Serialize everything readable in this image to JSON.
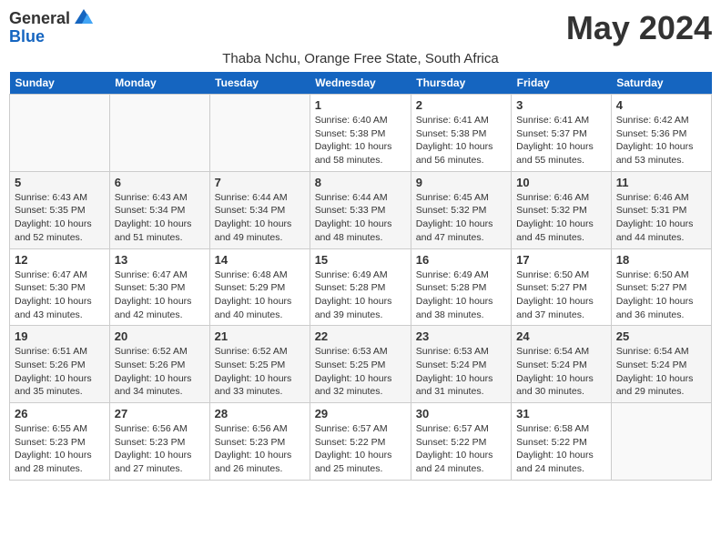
{
  "header": {
    "logo_general": "General",
    "logo_blue": "Blue",
    "month_title": "May 2024",
    "location": "Thaba Nchu, Orange Free State, South Africa"
  },
  "days_of_week": [
    "Sunday",
    "Monday",
    "Tuesday",
    "Wednesday",
    "Thursday",
    "Friday",
    "Saturday"
  ],
  "weeks": [
    [
      {
        "day": "",
        "info": ""
      },
      {
        "day": "",
        "info": ""
      },
      {
        "day": "",
        "info": ""
      },
      {
        "day": "1",
        "info": "Sunrise: 6:40 AM\nSunset: 5:38 PM\nDaylight: 10 hours and 58 minutes."
      },
      {
        "day": "2",
        "info": "Sunrise: 6:41 AM\nSunset: 5:38 PM\nDaylight: 10 hours and 56 minutes."
      },
      {
        "day": "3",
        "info": "Sunrise: 6:41 AM\nSunset: 5:37 PM\nDaylight: 10 hours and 55 minutes."
      },
      {
        "day": "4",
        "info": "Sunrise: 6:42 AM\nSunset: 5:36 PM\nDaylight: 10 hours and 53 minutes."
      }
    ],
    [
      {
        "day": "5",
        "info": "Sunrise: 6:43 AM\nSunset: 5:35 PM\nDaylight: 10 hours and 52 minutes."
      },
      {
        "day": "6",
        "info": "Sunrise: 6:43 AM\nSunset: 5:34 PM\nDaylight: 10 hours and 51 minutes."
      },
      {
        "day": "7",
        "info": "Sunrise: 6:44 AM\nSunset: 5:34 PM\nDaylight: 10 hours and 49 minutes."
      },
      {
        "day": "8",
        "info": "Sunrise: 6:44 AM\nSunset: 5:33 PM\nDaylight: 10 hours and 48 minutes."
      },
      {
        "day": "9",
        "info": "Sunrise: 6:45 AM\nSunset: 5:32 PM\nDaylight: 10 hours and 47 minutes."
      },
      {
        "day": "10",
        "info": "Sunrise: 6:46 AM\nSunset: 5:32 PM\nDaylight: 10 hours and 45 minutes."
      },
      {
        "day": "11",
        "info": "Sunrise: 6:46 AM\nSunset: 5:31 PM\nDaylight: 10 hours and 44 minutes."
      }
    ],
    [
      {
        "day": "12",
        "info": "Sunrise: 6:47 AM\nSunset: 5:30 PM\nDaylight: 10 hours and 43 minutes."
      },
      {
        "day": "13",
        "info": "Sunrise: 6:47 AM\nSunset: 5:30 PM\nDaylight: 10 hours and 42 minutes."
      },
      {
        "day": "14",
        "info": "Sunrise: 6:48 AM\nSunset: 5:29 PM\nDaylight: 10 hours and 40 minutes."
      },
      {
        "day": "15",
        "info": "Sunrise: 6:49 AM\nSunset: 5:28 PM\nDaylight: 10 hours and 39 minutes."
      },
      {
        "day": "16",
        "info": "Sunrise: 6:49 AM\nSunset: 5:28 PM\nDaylight: 10 hours and 38 minutes."
      },
      {
        "day": "17",
        "info": "Sunrise: 6:50 AM\nSunset: 5:27 PM\nDaylight: 10 hours and 37 minutes."
      },
      {
        "day": "18",
        "info": "Sunrise: 6:50 AM\nSunset: 5:27 PM\nDaylight: 10 hours and 36 minutes."
      }
    ],
    [
      {
        "day": "19",
        "info": "Sunrise: 6:51 AM\nSunset: 5:26 PM\nDaylight: 10 hours and 35 minutes."
      },
      {
        "day": "20",
        "info": "Sunrise: 6:52 AM\nSunset: 5:26 PM\nDaylight: 10 hours and 34 minutes."
      },
      {
        "day": "21",
        "info": "Sunrise: 6:52 AM\nSunset: 5:25 PM\nDaylight: 10 hours and 33 minutes."
      },
      {
        "day": "22",
        "info": "Sunrise: 6:53 AM\nSunset: 5:25 PM\nDaylight: 10 hours and 32 minutes."
      },
      {
        "day": "23",
        "info": "Sunrise: 6:53 AM\nSunset: 5:24 PM\nDaylight: 10 hours and 31 minutes."
      },
      {
        "day": "24",
        "info": "Sunrise: 6:54 AM\nSunset: 5:24 PM\nDaylight: 10 hours and 30 minutes."
      },
      {
        "day": "25",
        "info": "Sunrise: 6:54 AM\nSunset: 5:24 PM\nDaylight: 10 hours and 29 minutes."
      }
    ],
    [
      {
        "day": "26",
        "info": "Sunrise: 6:55 AM\nSunset: 5:23 PM\nDaylight: 10 hours and 28 minutes."
      },
      {
        "day": "27",
        "info": "Sunrise: 6:56 AM\nSunset: 5:23 PM\nDaylight: 10 hours and 27 minutes."
      },
      {
        "day": "28",
        "info": "Sunrise: 6:56 AM\nSunset: 5:23 PM\nDaylight: 10 hours and 26 minutes."
      },
      {
        "day": "29",
        "info": "Sunrise: 6:57 AM\nSunset: 5:22 PM\nDaylight: 10 hours and 25 minutes."
      },
      {
        "day": "30",
        "info": "Sunrise: 6:57 AM\nSunset: 5:22 PM\nDaylight: 10 hours and 24 minutes."
      },
      {
        "day": "31",
        "info": "Sunrise: 6:58 AM\nSunset: 5:22 PM\nDaylight: 10 hours and 24 minutes."
      },
      {
        "day": "",
        "info": ""
      }
    ]
  ]
}
